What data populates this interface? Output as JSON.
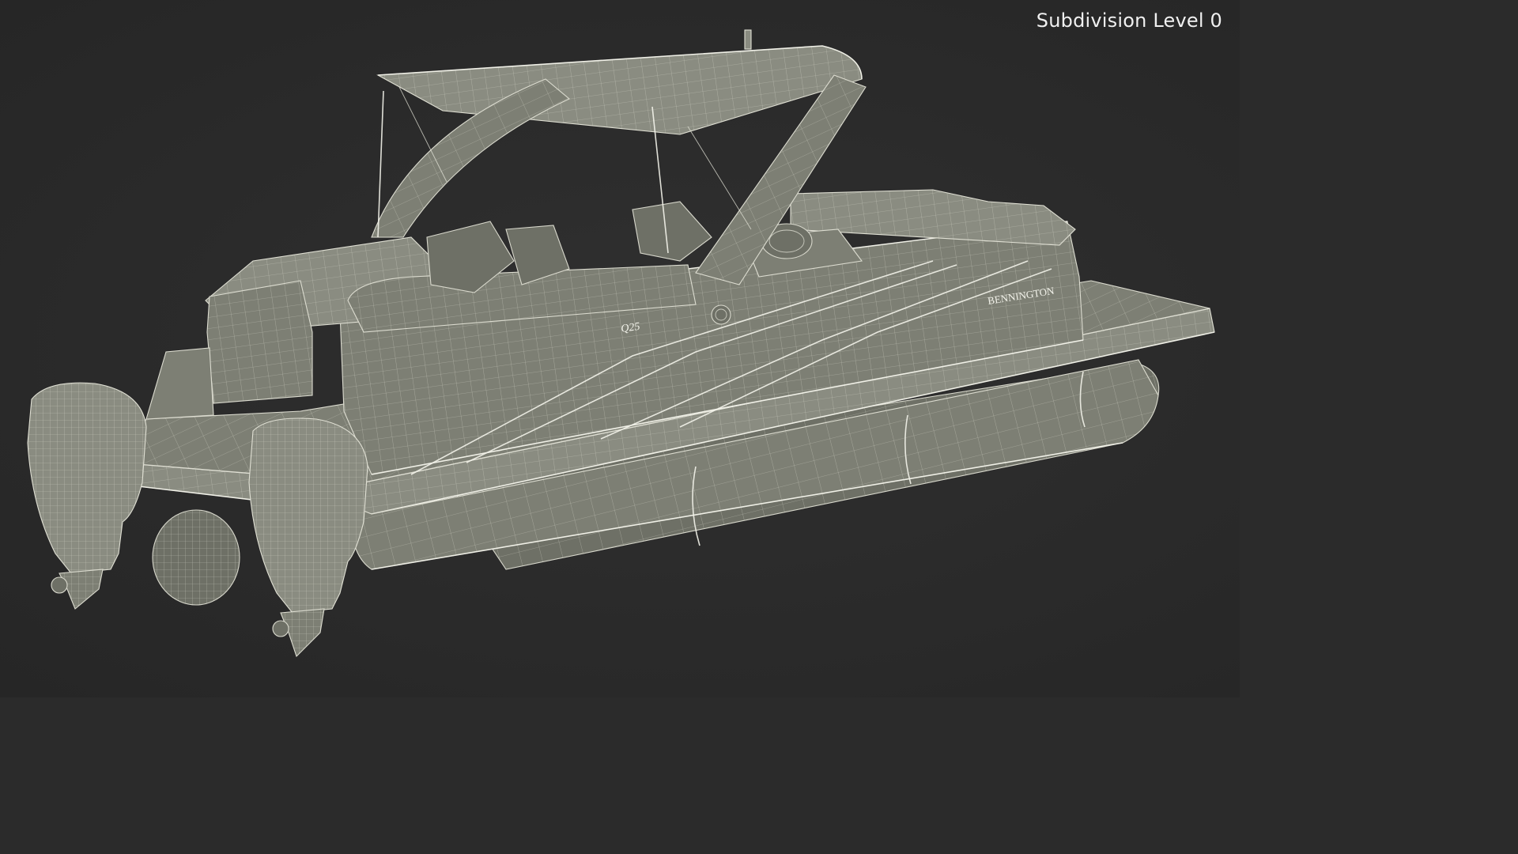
{
  "viewport": {
    "level_label": "Subdivision Level 0"
  },
  "boat": {
    "brand": "BENNINGTON",
    "model_badge": "Q25"
  },
  "colors": {
    "background": "#2b2b2b",
    "model_surface": "#7d7f74",
    "wireframe": "#e8e8dc",
    "label_text": "#f0f0f0"
  }
}
